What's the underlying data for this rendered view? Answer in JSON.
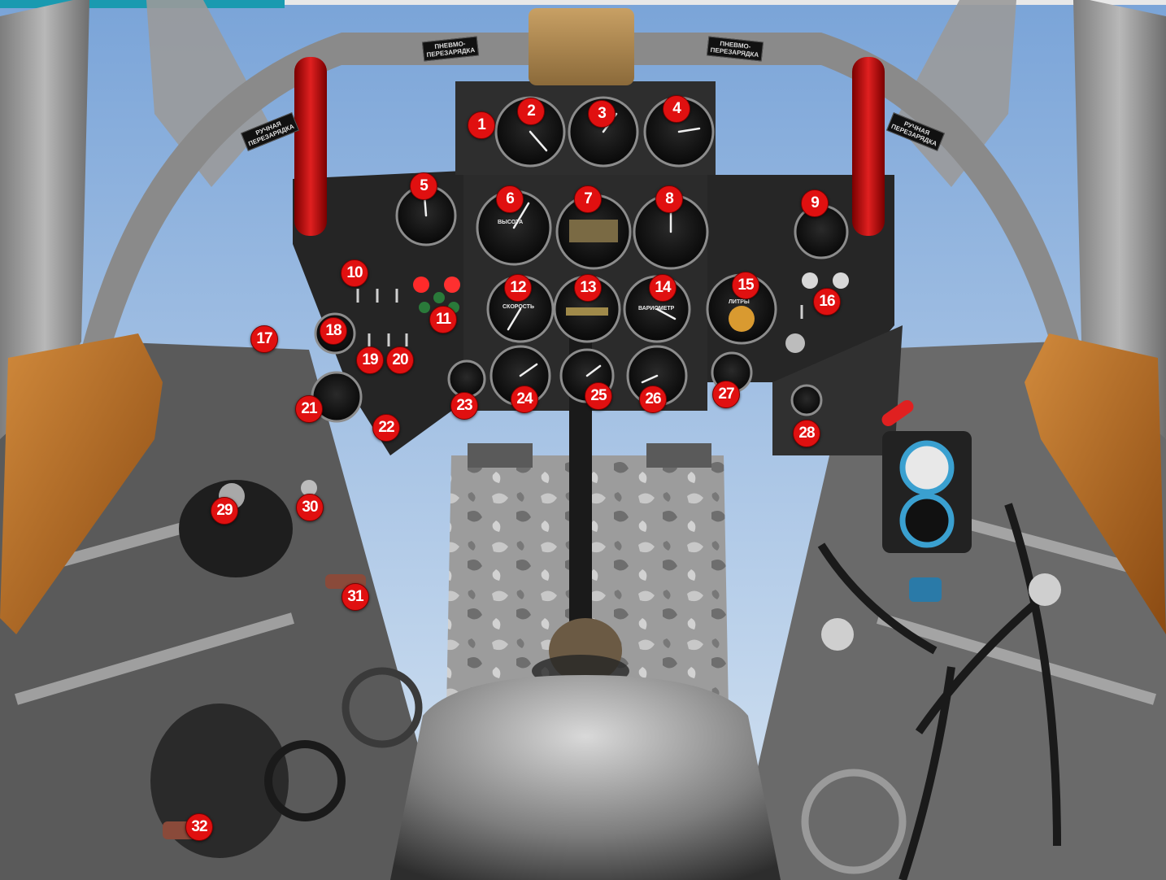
{
  "markers": [
    {
      "label": "1"
    },
    {
      "label": "2"
    },
    {
      "label": "3"
    },
    {
      "label": "4"
    },
    {
      "label": "5"
    },
    {
      "label": "6"
    },
    {
      "label": "7"
    },
    {
      "label": "8"
    },
    {
      "label": "9"
    },
    {
      "label": "10"
    },
    {
      "label": "11"
    },
    {
      "label": "12"
    },
    {
      "label": "13"
    },
    {
      "label": "14"
    },
    {
      "label": "15"
    },
    {
      "label": "16"
    },
    {
      "label": "17"
    },
    {
      "label": "18"
    },
    {
      "label": "19"
    },
    {
      "label": "20"
    },
    {
      "label": "21"
    },
    {
      "label": "22"
    },
    {
      "label": "23"
    },
    {
      "label": "24"
    },
    {
      "label": "25"
    },
    {
      "label": "26"
    },
    {
      "label": "27"
    },
    {
      "label": "28"
    },
    {
      "label": "29"
    },
    {
      "label": "30"
    },
    {
      "label": "31"
    },
    {
      "label": "32"
    }
  ],
  "placards": {
    "pneumo_left": [
      "ПНЕВМО-",
      "ПЕРЕЗАРЯДКА"
    ],
    "pneumo_right": [
      "ПНЕВМО-",
      "ПЕРЕЗАРЯДКА"
    ],
    "manual_left": [
      "РУЧНАЯ",
      "ПЕРЕЗАРЯДКА"
    ],
    "manual_right": [
      "РУЧНАЯ",
      "ПЕРЕЗАРЯДКА"
    ]
  },
  "gauge_labels": {
    "altimeter": "ВЫСОТА",
    "speed": "СКОРОСТЬ",
    "vario": "ВАРИОМЕТР",
    "fuel": "ЛИТРЫ"
  },
  "colors": {
    "marker": "#e01010",
    "sky": "#8fb4e0",
    "panel": "#2b2b2b",
    "frame": "#9a9a9a",
    "red_handle": "#c01010",
    "leather": "#b86a1e",
    "headrest": "#b58d4f",
    "blue_ring": "#3aa0d0"
  }
}
